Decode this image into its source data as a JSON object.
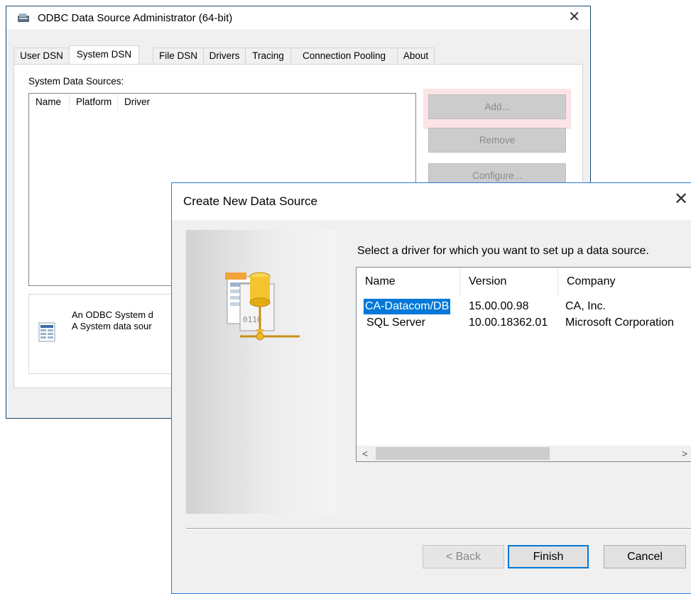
{
  "main_window": {
    "title": "ODBC Data Source Administrator (64-bit)",
    "close": "✕",
    "tabs": [
      "User DSN",
      "System DSN",
      "File DSN",
      "Drivers",
      "Tracing",
      "Connection Pooling",
      "About"
    ],
    "active_tab": "System DSN",
    "list_label": "System Data Sources:",
    "columns": [
      "Name",
      "Platform",
      "Driver"
    ],
    "buttons": {
      "add": "Add...",
      "remove": "Remove",
      "configure": "Configure..."
    },
    "info_line1": "An ODBC System d",
    "info_line2": "A System data sour"
  },
  "dialog": {
    "title": "Create New Data Source",
    "close": "✕",
    "prompt": "Select a driver for which you want to set up a data source.",
    "columns": [
      "Name",
      "Version",
      "Company"
    ],
    "drivers": [
      {
        "name": "CA-Datacom/DB",
        "version": "15.00.00.98",
        "company": "CA, Inc.",
        "selected": true
      },
      {
        "name": "SQL Server",
        "version": "10.00.18362.01",
        "company": "Microsoft Corporation",
        "selected": false
      }
    ],
    "scroll_left": "<",
    "scroll_right": ">",
    "buttons": {
      "back": "< Back",
      "finish": "Finish",
      "cancel": "Cancel"
    }
  },
  "colors": {
    "selection": "#0078d7",
    "add_highlight": "#fbe3e6",
    "window_border": "#2b79d6"
  }
}
